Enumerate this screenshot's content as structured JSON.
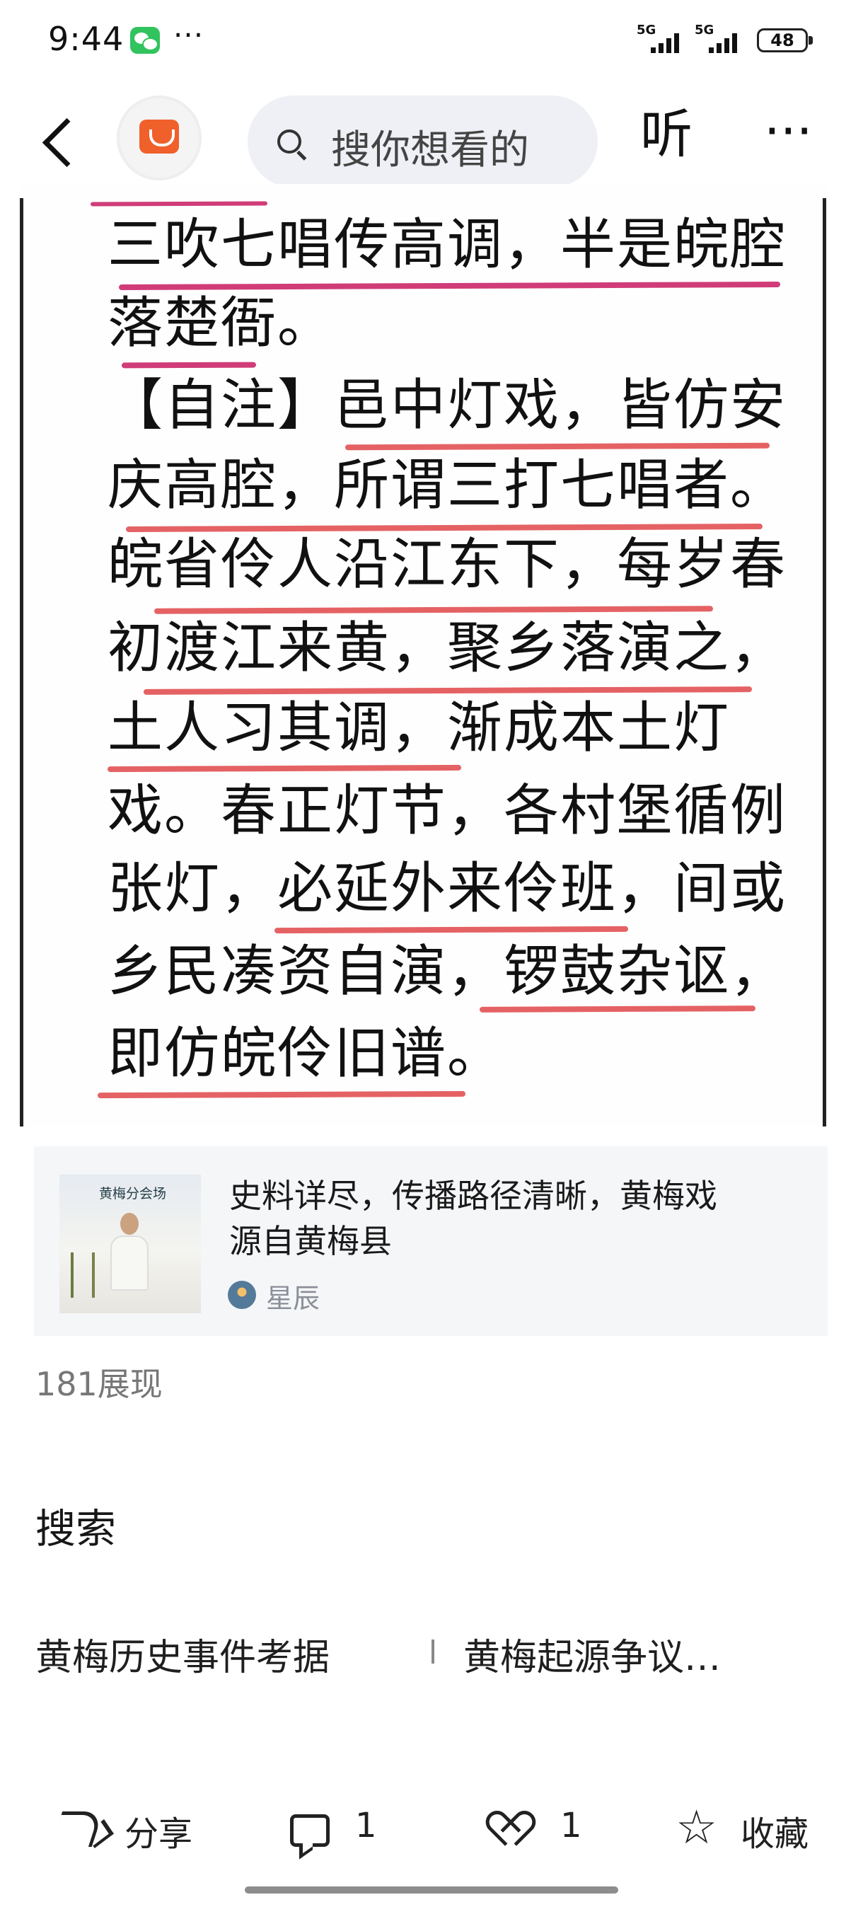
{
  "status_bar": {
    "time": "9:44",
    "more": "···",
    "signals": [
      "5G",
      "5G"
    ],
    "battery": "48",
    "app_icon": "wechat-icon"
  },
  "nav": {
    "back_icon": "back-arrow-icon",
    "avatar_icon": "red-gift-bag-icon",
    "search_placeholder": "搜你想看的",
    "listen": "听",
    "more": "···"
  },
  "article": {
    "lines": [
      "三吹七唱传高调，半是皖腔",
      "落楚衙。",
      "【自注】邑中灯戏，皆仿安",
      "庆高腔，所谓三打七唱者。",
      "皖省伶人沿江东下，每岁春",
      "初渡江来黄，聚乡落演之，",
      "土人习其调，渐成本土灯",
      "戏。春正灯节，各村堡循例",
      "张灯，必延外来伶班，间或",
      "乡民凑资自演，锣鼓杂讴，",
      "即仿皖伶旧谱。"
    ],
    "highlight_colors": {
      "pink": "#d03c78",
      "red": "#e1484b"
    }
  },
  "quote_card": {
    "thumbnail_title": "黄梅分会场",
    "title": "史料详尽，传播路径清晰，黄梅戏\n源自黄梅县",
    "author": "星辰"
  },
  "stats": {
    "views": "181展现"
  },
  "search_section": {
    "title": "搜索",
    "suggestions": [
      "黄梅历史事件考据",
      "黄梅起源争议…"
    ]
  },
  "actions": {
    "share": "分享",
    "comments": "1",
    "likes": "1",
    "collect": "收藏"
  }
}
